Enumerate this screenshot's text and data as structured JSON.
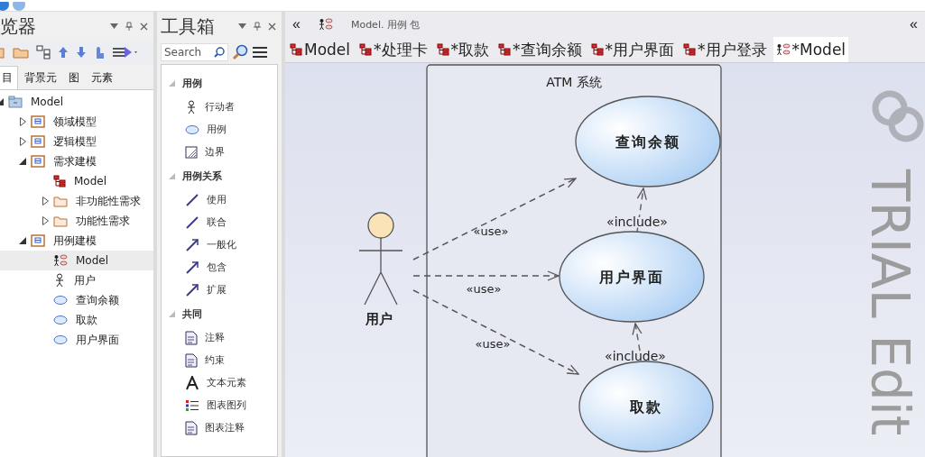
{
  "explorer": {
    "title": "览器",
    "tabs": [
      {
        "label": "目",
        "selected": true
      },
      {
        "label": "背景元",
        "selected": false
      },
      {
        "label": "图",
        "selected": false
      },
      {
        "label": "元素",
        "selected": false
      }
    ],
    "tree": [
      {
        "label": "Model",
        "kind": "package",
        "expanded": true,
        "selected": false,
        "children": [
          {
            "label": "领域模型",
            "kind": "module",
            "expanded": false,
            "selected": false
          },
          {
            "label": "逻辑模型",
            "kind": "module",
            "expanded": false,
            "selected": false
          },
          {
            "label": "需求建模",
            "kind": "module",
            "expanded": true,
            "selected": false,
            "children": [
              {
                "label": "Model",
                "kind": "class-diagram",
                "selected": false
              },
              {
                "label": "非功能性需求",
                "kind": "folder",
                "expanded": false,
                "selected": false
              },
              {
                "label": "功能性需求",
                "kind": "folder",
                "expanded": false,
                "selected": false
              }
            ]
          },
          {
            "label": "用例建模",
            "kind": "module",
            "expanded": true,
            "selected": false,
            "children": [
              {
                "label": "Model",
                "kind": "usecase-diagram",
                "selected": true
              },
              {
                "label": "用户",
                "kind": "actor",
                "selected": false
              },
              {
                "label": "查询余额",
                "kind": "usecase",
                "selected": false
              },
              {
                "label": "取款",
                "kind": "usecase",
                "selected": false
              },
              {
                "label": "用户界面",
                "kind": "usecase",
                "selected": false
              }
            ]
          }
        ]
      }
    ]
  },
  "toolbox": {
    "title": "工具箱",
    "search": {
      "placeholder": "Search"
    },
    "groups": [
      {
        "title": "用例",
        "expanded": true,
        "items": [
          {
            "label": "行动者",
            "kind": "actor"
          },
          {
            "label": "用例",
            "kind": "usecase"
          },
          {
            "label": "边界",
            "kind": "boundary"
          }
        ]
      },
      {
        "title": "用例关系",
        "expanded": true,
        "items": [
          {
            "label": "使用",
            "kind": "use"
          },
          {
            "label": "联合",
            "kind": "line"
          },
          {
            "label": "一般化",
            "kind": "arrow"
          },
          {
            "label": "包含",
            "kind": "include"
          },
          {
            "label": "扩展",
            "kind": "extend"
          }
        ]
      },
      {
        "title": "共同",
        "expanded": true,
        "items": [
          {
            "label": "注释",
            "kind": "note"
          },
          {
            "label": "约束",
            "kind": "constraint"
          },
          {
            "label": "文本元素",
            "kind": "text"
          },
          {
            "label": "图表图列",
            "kind": "legend"
          },
          {
            "label": "图表注释",
            "kind": "note2"
          }
        ]
      }
    ]
  },
  "diagram": {
    "collapse_left": "«",
    "collapse_right": "«",
    "breadcrumb": "Model.  用例 包",
    "tabs": [
      {
        "label": "Model",
        "kind": "class-diagram",
        "selected": false
      },
      {
        "label": "*处理卡",
        "kind": "class-diagram",
        "selected": false
      },
      {
        "label": "*取款",
        "kind": "class-diagram",
        "selected": false
      },
      {
        "label": "*查询余额",
        "kind": "class-diagram",
        "selected": false
      },
      {
        "label": "*用户界面",
        "kind": "class-diagram",
        "selected": false
      },
      {
        "label": "*用户登录",
        "kind": "class-diagram",
        "selected": false
      },
      {
        "label": "*Model",
        "kind": "usecase-diagram",
        "selected": true
      }
    ],
    "boundary": {
      "title": "ATM 系统"
    },
    "actor": {
      "label": "用户"
    },
    "use_cases": [
      {
        "label": "查询余额"
      },
      {
        "label": "用户界面"
      },
      {
        "label": "取款"
      }
    ],
    "connectors": [
      {
        "kind": "use",
        "label": "«use»"
      },
      {
        "kind": "use",
        "label": "«use»"
      },
      {
        "kind": "use",
        "label": "«use»"
      },
      {
        "kind": "include",
        "label": "«include»"
      },
      {
        "kind": "include",
        "label": "«include»"
      }
    ],
    "watermark": "TRIAL Edit"
  }
}
